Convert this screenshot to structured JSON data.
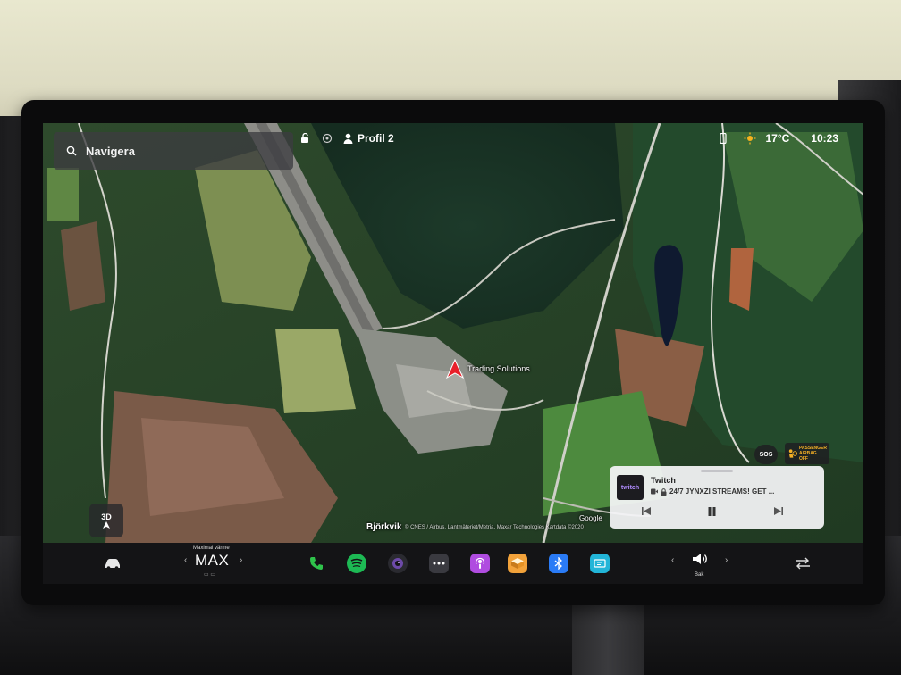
{
  "search": {
    "placeholder": "Navigera"
  },
  "status_bar": {
    "profile_name": "Profil 2",
    "temperature": "17°C",
    "time": "10:23"
  },
  "map": {
    "pin_label": "Trading Solutions",
    "place_name": "Björkvik",
    "compass_mode": "3D",
    "attribution": "Google",
    "copyright": "© CNES / Airbus, Lantmäteriet/Metria, Maxar Technologies Kartdata ©2020"
  },
  "safety": {
    "sos_label": "SOS",
    "airbag_line1": "PASSENGER",
    "airbag_line2": "AIRBAG",
    "airbag_line3": "OFF"
  },
  "media": {
    "source": "Twitch",
    "art_label": "twitch",
    "track": "24/7 JYNXZI STREAMS! GET ..."
  },
  "climate": {
    "heat_label": "Maximal värme",
    "heat_value": "MAX"
  },
  "volume": {
    "label": "Bak"
  },
  "colors": {
    "phone": "#2fc34b",
    "spotify": "#1db954",
    "podcasts": "#b04ce0",
    "toybox": "#f2a23a",
    "bluetooth": "#2a7bf6",
    "screen": "#22b5d8",
    "pin": "#e8202a",
    "sun": "#f6b21e"
  }
}
